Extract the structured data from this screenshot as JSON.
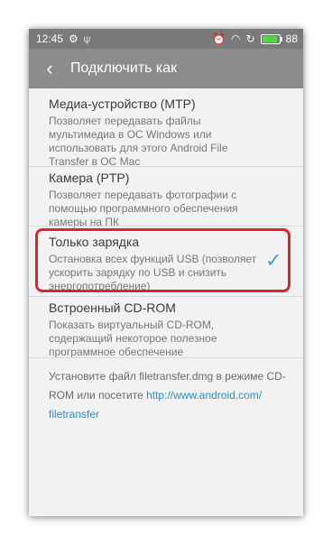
{
  "status": {
    "time": "12:45",
    "left_icons": [
      "settings-icon",
      "usb-icon"
    ],
    "right_icons": [
      "alarm-icon",
      "wifi-icon",
      "sync-icon"
    ],
    "battery_level": "88"
  },
  "appbar": {
    "back_icon": "back-arrow-icon",
    "title": "Подключить как"
  },
  "options": [
    {
      "title": "Медиа-устройство (MTP)",
      "desc_lines": [
        "Позволяет передавать файлы",
        "мультимедиа в ОС Windows или",
        "использовать для этого Android File",
        "Transfer в ОС Mac"
      ],
      "selected": false
    },
    {
      "title": "Камера (PTP)",
      "desc_lines": [
        "Позволяет передавать фотографии с",
        "помощью программного обеспечения",
        "камеры на ПК"
      ],
      "selected": false
    },
    {
      "title": "Только зарядка",
      "desc_lines": [
        "Остановка всех функций USB (позволяет",
        "ускорить зарядку по USB и снизить",
        "энергопотребление)"
      ],
      "selected": true,
      "check_icon": "checkmark-icon"
    },
    {
      "title": "Встроенный CD-ROM",
      "desc_lines": [
        "Показать виртуальный CD-ROM,",
        "содержащий некоторое полезное",
        "программное обеспечение"
      ],
      "selected": false
    }
  ],
  "footer": {
    "line1": "Установите файл filetransfer.dmg в режиме CD-",
    "line2_text": "ROM или посетите ",
    "link_part1": "http://www.android.com/",
    "link_part2": "filetransfer"
  },
  "colors": {
    "accent": "#3aa0d8",
    "highlight_border": "#d8262c",
    "appbar": "#8c8c8c",
    "statusbar": "#7a7a7a"
  }
}
